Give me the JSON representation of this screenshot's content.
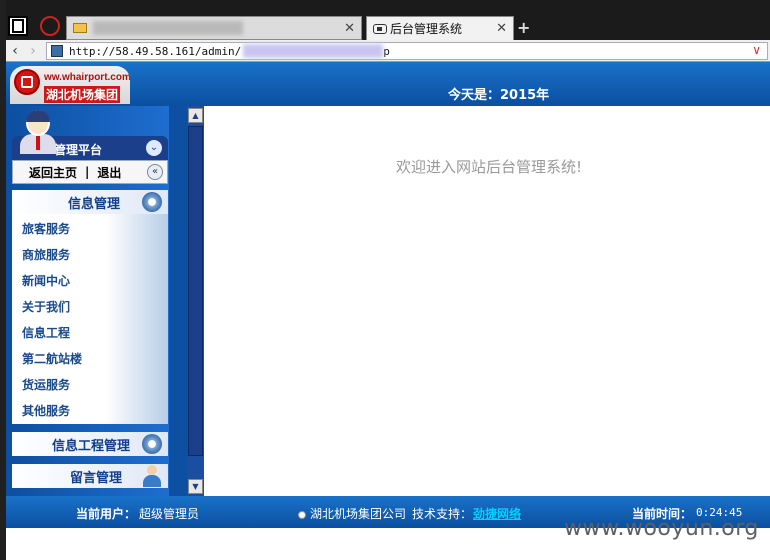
{
  "browser": {
    "active_tab_title": "后台管理系统",
    "tab_close": "✕",
    "new_tab": "+",
    "url_prefix": "http://58.49.58.161/admin/",
    "url_suffix": "p",
    "nav_back": "‹",
    "nav_forward": "›",
    "url_dropdown": "∨"
  },
  "header": {
    "logo_url": "ww.whairport.com",
    "logo_name": "湖北机场集团",
    "date": "今天是：2015年"
  },
  "sidebar": {
    "platform_title": "管理平台",
    "home_link": "返回主页",
    "separator": "|",
    "logout_link": "退出",
    "sections": {
      "info": "信息管理",
      "project": "信息工程管理",
      "message": "留言管理"
    },
    "menu_items": [
      "旅客服务",
      "商旅服务",
      "新闻中心",
      "关于我们",
      "信息工程",
      "第二航站楼",
      "货运服务",
      "其他服务"
    ]
  },
  "content": {
    "welcome": "欢迎进入网站后台管理系统!"
  },
  "footer": {
    "user_label": "当前用户：",
    "user_value": "超级管理员",
    "company": "湖北机场集团公司",
    "support_label": "技术支持：",
    "support_value": "劲捷网络",
    "time_label": "当前时间：",
    "time_value": "0:24:45"
  },
  "watermark": "www.wooyun.org",
  "colors": {
    "header_blue": "#1a72c9",
    "sidebar_blue": "#0d4fa0",
    "support_link": "#00d0ff"
  }
}
